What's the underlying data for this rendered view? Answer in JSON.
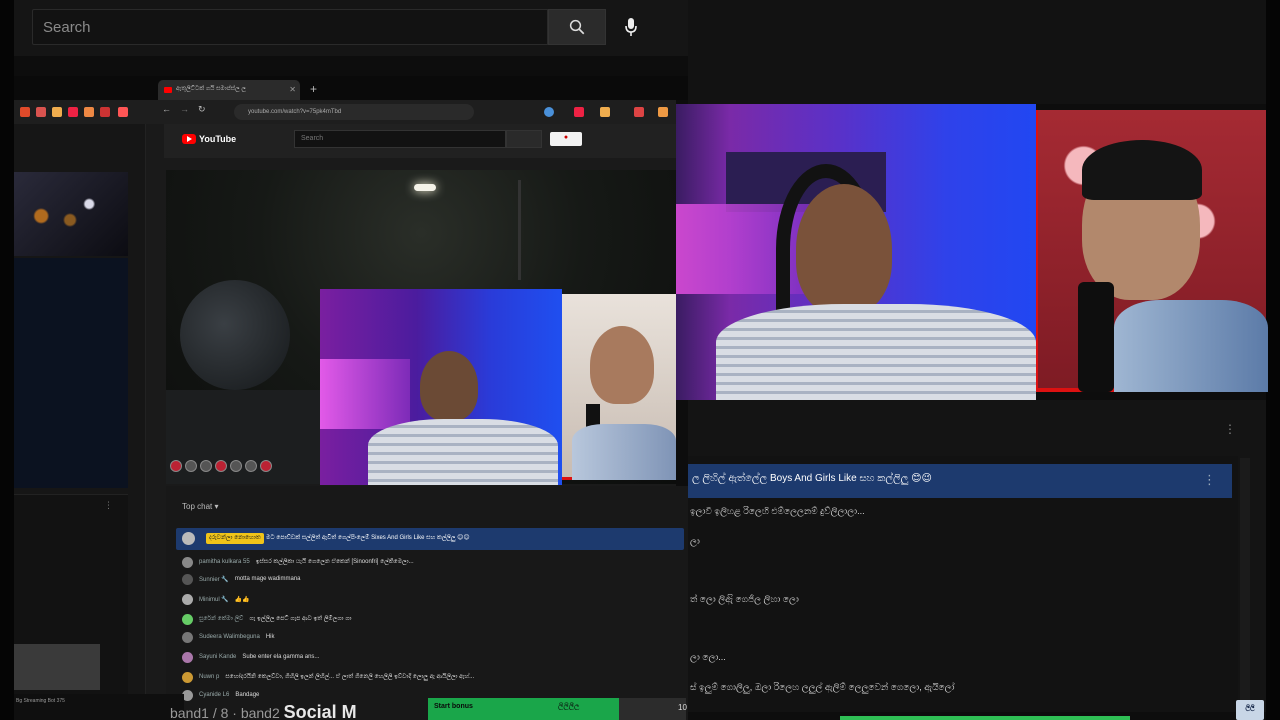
{
  "search": {
    "placeholder": "Search"
  },
  "browser": {
    "tab_title": "ඇතුලිට්ටක් ගයි සමාප්ස්ල ල",
    "url": "youtube.com/watch?v=75pk4mTbd"
  },
  "inner_youtube": {
    "logo_text": "YouTube",
    "search_placeholder": "Search"
  },
  "chat_left": {
    "title": "Top chat ▾",
    "pinned": {
      "name": "දරුවන්ලා නොහොත",
      "message": "මට පොඩ්ඩක් සල්ලිත් ඇවිත් ගෙල්පිංලෙම් Sixes And Girls Like සහ කල්ලිලු 😊😊"
    },
    "rows": [
      {
        "name": "pamitha kulkara 55",
        "text": "ඉස්සර කල්ලිකා යැයි ගෙලෙන ඒකෙන් [Sinoonfri] ලේකිමෙලා..."
      },
      {
        "name": "Sunnier 🔧",
        "text": "motta mage wadimmana"
      },
      {
        "name": "Minimul 🔧",
        "text": "👍👍"
      },
      {
        "name": "සුරේන් කේමා ලිව්",
        "text": "ගැ ඉල්ලිල පෙට් ගැප ආව ඉත් ලිම්ලගා ගා"
      },
      {
        "name": "Sudeera Walimbeguna",
        "text": "Hik"
      },
      {
        "name": "Sayuni Kande",
        "text": "Sube enter ela gamma ans..."
      },
      {
        "name": "Nuwn p",
        "text": "සහෝදරයිනි කෙලව්වා, ගිහිලි ඉලන් ලිහිල්... ඒ ලාත් ගිනෙලි හෙලිලි ඉව්වාදි ලොලු ඇ ආයිලිලා ඇහ්..."
      },
      {
        "name": "Cyanide L6",
        "text": "Bandage"
      }
    ]
  },
  "chat_right": {
    "pinned_message": "ල ලිහිල් ඇත්ලේල Boys And Girls Like සහ කල්ලිලු 😊😉",
    "lines": [
      "ඉලාවී ඉලිහළ රිලෙහි එම්ලෙලනම් දුව්ලිලාලා...",
      "ලා",
      "ත් ලො ලිඇි ගෙජිල ලිහා ලො",
      "ලා ලො...",
      "ස් ඉලුම් ගොලිලු, ඔලා රිලෙහ ලලුල් ඇලිම් ලෙලුවෙන් ගෙලො, ඇයිලෝ"
    ]
  },
  "bottom": {
    "sidebar_text": "Bg Streaming Bot 375",
    "scene_text": "band1 / 8 · band2",
    "scene_bold": "Social M",
    "bonus_label": "Start bonus",
    "bonus_mid": "ලිලිලීල",
    "bonus_right": "10",
    "bonus_progress": 0.74
  },
  "watermark": "ලිලි"
}
